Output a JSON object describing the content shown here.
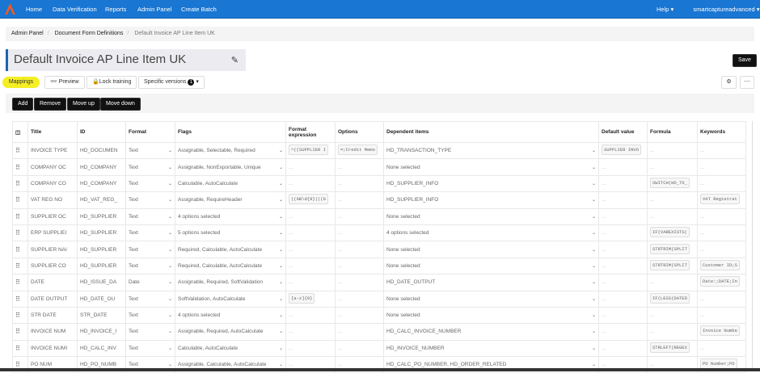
{
  "nav": {
    "items": [
      "Home",
      "Data Verification",
      "Reports",
      "Admin Panel",
      "Create Batch"
    ],
    "help": "Help",
    "user": "smartcaptureadvanced",
    "brand_color": "#1976d2"
  },
  "breadcrumb": [
    "Admin Panel",
    "Document Form Definitions",
    "Default Invoice AP Line Item UK"
  ],
  "title": "Default Invoice AP Line Item UK",
  "save": "Save",
  "tabs": {
    "mappings": "Mappings",
    "preview": "Preview",
    "lock": "Lock training",
    "versions": "Specific versions",
    "versions_count": "1"
  },
  "toolbar": {
    "add": "Add",
    "remove": "Remove",
    "up": "Move up",
    "down": "Move down"
  },
  "columns": [
    "Title",
    "ID",
    "Format",
    "Flags",
    "Format expression",
    "Options",
    "Dependent items",
    "Default value",
    "Formula",
    "Keywords"
  ],
  "rows": [
    {
      "title": "INVOICE TYPE",
      "id": "HD_DOCUMEN",
      "format": "Text",
      "flags": "Assignable, Selectable, Required",
      "fexpr": "^((SUPPLIER I",
      "options": "=;Credit Memo",
      "dep": "HD_TRANSACTION_TYPE",
      "def": "SUPPLIER INVO",
      "formula": "",
      "kw": ""
    },
    {
      "title": "COMPANY OC",
      "id": "HD_COMPANY",
      "format": "Text",
      "flags": "Assignable, NonExportable, Unique",
      "fexpr": "",
      "options": "",
      "dep": "None selected",
      "def": "",
      "formula": "",
      "kw": ""
    },
    {
      "title": "COMPANY CO",
      "id": "HD_COMPANY",
      "format": "Text",
      "flags": "Calculable, AutoCalculate",
      "fexpr": "",
      "options": "",
      "dep": "HD_SUPPLIER_INFO",
      "def": "",
      "formula": "SWITCH(HD_TO_",
      "kw": ""
    },
    {
      "title": "VAT REG NO",
      "id": "HD_VAT_REG_",
      "format": "Text",
      "flags": "Assignable, RequireHeader",
      "fexpr": "((GB\\d{9})|(G",
      "options": "",
      "dep": "HD_SUPPLIER_INFO",
      "def": "",
      "formula": "",
      "kw": "VAT Registrat"
    },
    {
      "title": "SUPPLIER OC",
      "id": "HD_SUPPLIER",
      "format": "Text",
      "flags": "4 options selected",
      "fexpr": "",
      "options": "",
      "dep": "None selected",
      "def": "",
      "formula": "",
      "kw": ""
    },
    {
      "title": "ERP SUPPLIEI",
      "id": "HD_SUPPLIER",
      "format": "Text",
      "flags": "5 options selected",
      "fexpr": "",
      "options": "",
      "dep": "4 options selected",
      "def": "",
      "formula": "IF(VAREXISTS(",
      "kw": ""
    },
    {
      "title": "SUPPLIER NAI",
      "id": "HD_SUPPLIER",
      "format": "Text",
      "flags": "Required, Calculable, AutoCalculate",
      "fexpr": "",
      "options": "",
      "dep": "None selected",
      "def": "",
      "formula": "STRTRIM(SPLIT",
      "kw": ""
    },
    {
      "title": "SUPPLIER CO",
      "id": "HD_SUPPLIER",
      "format": "Text",
      "flags": "Required, Calculable, AutoCalculate",
      "fexpr": "",
      "options": "",
      "dep": "None selected",
      "def": "",
      "formula": "STRTRIM(SPLIT",
      "kw": "Customer ID;S"
    },
    {
      "title": "DATE",
      "id": "HD_ISSUE_DA",
      "format": "Date",
      "flags": "Assignable, Required, SoftValidation",
      "fexpr": "",
      "options": "",
      "dep": "HD_DATE_OUTPUT",
      "def": "",
      "formula": "",
      "kw": "Date:;DATE;In"
    },
    {
      "title": "DATE OUTPUT",
      "id": "HD_DATE_OU",
      "format": "Text",
      "flags": "SoftValidation, AutoCalculate",
      "fexpr": "[a-z]{0}",
      "options": "",
      "dep": "None selected",
      "def": "",
      "formula": "IF(LESS(DATED",
      "kw": ""
    },
    {
      "title": "STR DATE",
      "id": "STR_DATE",
      "format": "Text",
      "flags": "4 options selected",
      "fexpr": "",
      "options": "",
      "dep": "None selected",
      "def": "",
      "formula": "",
      "kw": ""
    },
    {
      "title": "INVOICE NUM",
      "id": "HD_INVOICE_I",
      "format": "Text",
      "flags": "Assignable, Required, AutoCalculate",
      "fexpr": "",
      "options": "",
      "dep": "HD_CALC_INVOICE_NUMBER",
      "def": "",
      "formula": "",
      "kw": "Invoice Numbe"
    },
    {
      "title": "INVOICE NUMI",
      "id": "HD_CALC_INV",
      "format": "Text",
      "flags": "Calculable, AutoCalculate",
      "fexpr": "",
      "options": "",
      "dep": "HD_INVOICE_NUMBER",
      "def": "",
      "formula": "STRLEFT(REGEX",
      "kw": ""
    },
    {
      "title": "PO NUM",
      "id": "HD_PO_NUMB",
      "format": "Text",
      "flags": "Assignable, Calculable, AutoCalculate",
      "fexpr": "",
      "options": "",
      "dep": "HD_CALC_PO_NUMBER, HD_ORDER_RELATED",
      "def": "",
      "formula": "",
      "kw": "PO Number;PO"
    }
  ],
  "empty": "..."
}
